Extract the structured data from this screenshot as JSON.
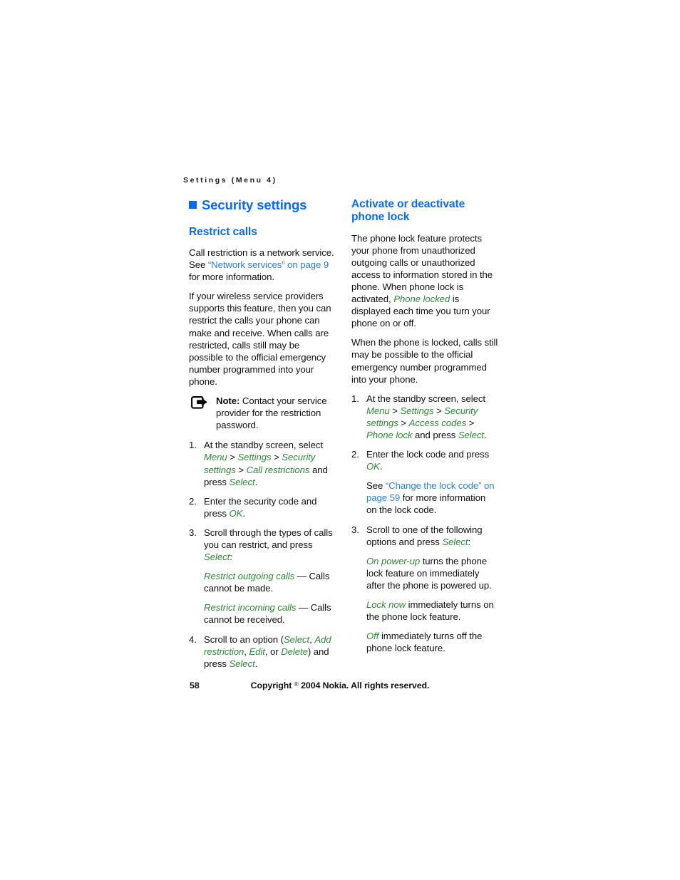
{
  "page": {
    "running_head": "Settings (Menu 4)",
    "page_number": "58",
    "copyright_prefix": "Copyright ",
    "copyright_symbol": "®",
    "copyright_suffix": " 2004 Nokia. All rights reserved.",
    "colors": {
      "heading_blue": "#0b69f3",
      "link_blue": "#2b7fe8",
      "ui_green": "#2e8b37",
      "body_black": "#111111",
      "background": "#ffffff"
    }
  },
  "left_column": {
    "chapter_heading": "Security settings",
    "section_heading": "Restrict calls",
    "para1_part1": "Call restriction is a network service. See ",
    "para1_link": "“Network services” on page 9",
    "para1_part2": " for more information.",
    "para2": "If your wireless service providers supports this feature, then you can restrict the calls your phone can make and receive. When calls are restricted, calls still may be possible to the official emergency number programmed into your phone.",
    "note": {
      "icon": "note-pointer-icon",
      "label": "Note:",
      "text": " Contact your service provider for the restriction password."
    },
    "steps": [
      {
        "id": "step-1",
        "segments": [
          {
            "text": "At the standby screen, select ",
            "style": "plain"
          },
          {
            "text": "Menu",
            "style": "green"
          },
          {
            "text": " > ",
            "style": "plain"
          },
          {
            "text": "Settings",
            "style": "green"
          },
          {
            "text": " > ",
            "style": "plain"
          },
          {
            "text": "Security settings",
            "style": "green"
          },
          {
            "text": " > ",
            "style": "plain"
          },
          {
            "text": "Call restrictions",
            "style": "green"
          },
          {
            "text": " and press ",
            "style": "plain"
          },
          {
            "text": "Select",
            "style": "green"
          },
          {
            "text": ".",
            "style": "plain"
          }
        ]
      },
      {
        "id": "step-2",
        "segments": [
          {
            "text": "Enter the security code and press ",
            "style": "plain"
          },
          {
            "text": "OK",
            "style": "green"
          },
          {
            "text": ".",
            "style": "plain"
          }
        ]
      },
      {
        "id": "step-3",
        "segments": [
          {
            "text": "Scroll through the types of calls you can restrict, and press ",
            "style": "plain"
          },
          {
            "text": "Select",
            "style": "green"
          },
          {
            "text": ":",
            "style": "plain"
          }
        ],
        "sub_paragraphs": [
          [
            {
              "text": "Restrict outgoing calls",
              "style": "green"
            },
            {
              "text": " — Calls cannot be made.",
              "style": "plain"
            }
          ],
          [
            {
              "text": "Restrict incoming calls",
              "style": "green"
            },
            {
              "text": " — Calls cannot be received.",
              "style": "plain"
            }
          ]
        ]
      },
      {
        "id": "step-4",
        "segments": [
          {
            "text": "Scroll to an option (",
            "style": "plain"
          },
          {
            "text": "Select",
            "style": "green"
          },
          {
            "text": ", ",
            "style": "plain"
          },
          {
            "text": "Add restriction",
            "style": "green"
          },
          {
            "text": ", ",
            "style": "plain"
          },
          {
            "text": "Edit",
            "style": "green"
          },
          {
            "text": ", or ",
            "style": "plain"
          },
          {
            "text": "Delete",
            "style": "green"
          },
          {
            "text": ") and press ",
            "style": "plain"
          },
          {
            "text": "Select",
            "style": "green"
          },
          {
            "text": ".",
            "style": "plain"
          }
        ]
      }
    ]
  },
  "right_column": {
    "section_heading": "Activate or deactivate phone lock",
    "para1_segments": [
      {
        "text": "The phone lock feature protects your phone from unauthorized outgoing calls or unauthorized access to information stored in the phone. When phone lock is activated, ",
        "style": "plain"
      },
      {
        "text": "Phone locked",
        "style": "green"
      },
      {
        "text": " is displayed each time you turn your phone on or off.",
        "style": "plain"
      }
    ],
    "para2": "When the phone is locked, calls still may be possible to the official emergency number programmed into your phone.",
    "steps": [
      {
        "id": "step-1",
        "segments": [
          {
            "text": "At the standby screen, select ",
            "style": "plain"
          },
          {
            "text": "Menu",
            "style": "green"
          },
          {
            "text": " > ",
            "style": "plain"
          },
          {
            "text": "Settings",
            "style": "green"
          },
          {
            "text": " > ",
            "style": "plain"
          },
          {
            "text": "Security settings",
            "style": "green"
          },
          {
            "text": " > ",
            "style": "plain"
          },
          {
            "text": "Access codes",
            "style": "green"
          },
          {
            "text": " > ",
            "style": "plain"
          },
          {
            "text": "Phone lock",
            "style": "green"
          },
          {
            "text": " and press ",
            "style": "plain"
          },
          {
            "text": "Select",
            "style": "green"
          },
          {
            "text": ".",
            "style": "plain"
          }
        ]
      },
      {
        "id": "step-2",
        "segments": [
          {
            "text": "Enter the lock code and press ",
            "style": "plain"
          },
          {
            "text": "OK",
            "style": "green"
          },
          {
            "text": ".",
            "style": "plain"
          }
        ],
        "sub_paragraphs": [
          [
            {
              "text": "See ",
              "style": "plain"
            },
            {
              "text": "“Change the lock code” on page 59",
              "style": "link"
            },
            {
              "text": " for more information on the lock code.",
              "style": "plain"
            }
          ]
        ]
      },
      {
        "id": "step-3",
        "segments": [
          {
            "text": "Scroll to one of the following options and press ",
            "style": "plain"
          },
          {
            "text": "Select",
            "style": "green"
          },
          {
            "text": ":",
            "style": "plain"
          }
        ],
        "sub_paragraphs": [
          [
            {
              "text": "On power-up",
              "style": "green"
            },
            {
              "text": " turns the phone lock feature on immediately after the phone is powered up.",
              "style": "plain"
            }
          ],
          [
            {
              "text": "Lock now",
              "style": "green"
            },
            {
              "text": " immediately turns on the phone lock feature.",
              "style": "plain"
            }
          ],
          [
            {
              "text": "Off",
              "style": "green"
            },
            {
              "text": " immediately turns off the phone lock feature.",
              "style": "plain"
            }
          ]
        ]
      }
    ]
  }
}
